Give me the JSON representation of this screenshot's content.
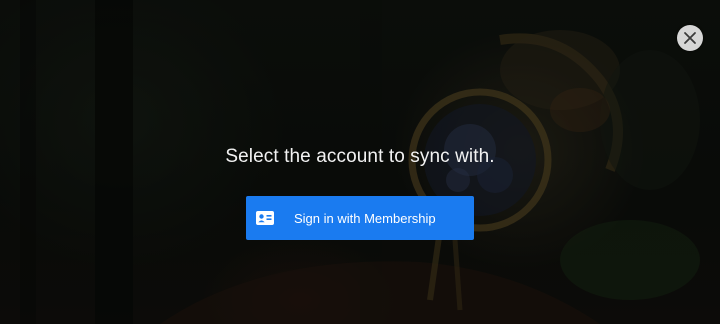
{
  "dialog": {
    "prompt": "Select the account to sync with.",
    "signin_button_label": "Sign in with Membership",
    "signin_icon": "member-card-icon",
    "close_icon": "close-icon"
  },
  "colors": {
    "accent": "#1a7bf0",
    "close_button_bg": "#d6d6d6",
    "prompt_text": "#f2f2f2"
  }
}
